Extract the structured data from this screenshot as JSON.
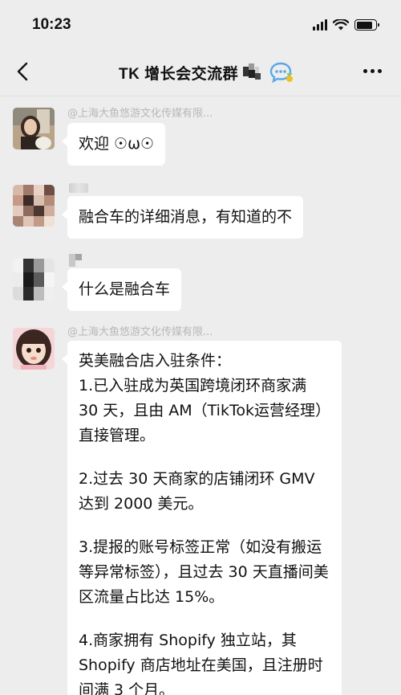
{
  "status_bar": {
    "time": "10:23",
    "icons": [
      "signal-icon",
      "wifi-icon",
      "battery-icon"
    ],
    "battery_level": 0.85
  },
  "nav": {
    "title": "TK 增长会交流群",
    "back_icon": "chevron-left-icon",
    "badge_icon": "chat-bubble-icon",
    "more_icon": "more-dots-icon",
    "accent_blue": "#5aa7ea",
    "accent_yellow": "#f3c020"
  },
  "messages": [
    {
      "sender": "@上海大鱼悠游文化传媒有限...",
      "text": "欢迎 ☉ω☉",
      "avatar": "photo-avatar-girl"
    },
    {
      "sender": "",
      "text": "融合车的详细消息，有知道的不",
      "avatar": "mosaic-avatar"
    },
    {
      "sender": "",
      "text": "什么是融合车",
      "avatar": "mosaic-avatar"
    },
    {
      "sender": "@上海大鱼悠游文化传媒有限...",
      "avatar": "photo-avatar-child",
      "paragraphs": [
        "英美融合店入驻条件：\n1.已入驻成为英国跨境闭环商家满 30 天，且由 AM（TikTok运营经理）直接管理。",
        "2.过去 30 天商家的店铺闭环 GMV 达到 2000 美元。",
        "3.提报的账号标签正常（如没有搬运等异常标签），且过去 30 天直播间美区流量占比达 15%。",
        "4.商家拥有 Shopify 独立站，其 Shopify 商店地址在美国，且注册时间满 3 个月。"
      ]
    }
  ]
}
